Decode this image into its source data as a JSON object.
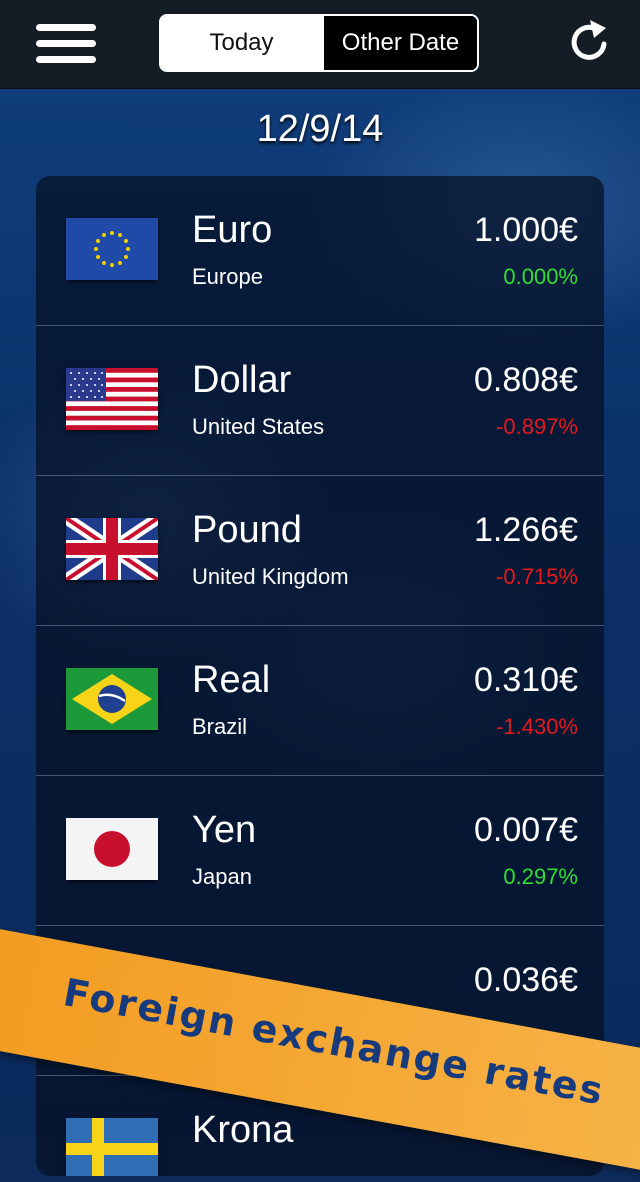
{
  "header": {
    "menu_icon": "hamburger-menu-icon",
    "tabs": [
      {
        "label": "Today",
        "active": true
      },
      {
        "label": "Other Date",
        "active": false
      }
    ],
    "refresh_icon": "refresh-icon"
  },
  "date": "12/9/14",
  "currencies": [
    {
      "name": "Euro",
      "country": "Europe",
      "rate": "1.000€",
      "change": "0.000%",
      "trend": "up",
      "flag": "eu-flag-icon"
    },
    {
      "name": "Dollar",
      "country": "United States",
      "rate": "0.808€",
      "change": "-0.897%",
      "trend": "down",
      "flag": "us-flag-icon"
    },
    {
      "name": "Pound",
      "country": "United Kingdom",
      "rate": "1.266€",
      "change": "-0.715%",
      "trend": "down",
      "flag": "uk-flag-icon"
    },
    {
      "name": "Real",
      "country": "Brazil",
      "rate": "0.310€",
      "change": "-1.430%",
      "trend": "down",
      "flag": "brazil-flag-icon"
    },
    {
      "name": "Yen",
      "country": "Japan",
      "rate": "0.007€",
      "change": "0.297%",
      "trend": "up",
      "flag": "japan-flag-icon"
    },
    {
      "name": "",
      "country": "",
      "rate": "0.036€",
      "change": "",
      "trend": "down",
      "flag": ""
    },
    {
      "name": "Krona",
      "country": "",
      "rate": "",
      "change": "",
      "trend": "",
      "flag": "sweden-flag-icon"
    }
  ],
  "banner": "Foreign exchange rates",
  "colors": {
    "positive": "#33dd33",
    "negative": "#e8191a",
    "banner": "#f29a1e",
    "banner_text": "#163a7c"
  }
}
